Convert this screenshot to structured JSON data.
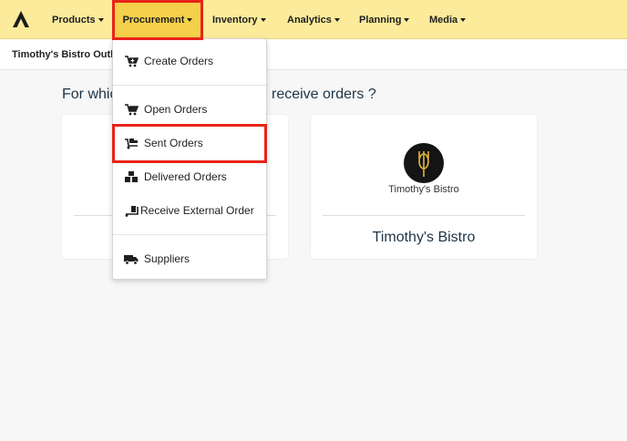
{
  "nav": {
    "items": [
      {
        "label": "Products"
      },
      {
        "label": "Procurement"
      },
      {
        "label": "Inventory"
      },
      {
        "label": "Analytics"
      },
      {
        "label": "Planning"
      },
      {
        "label": "Media"
      }
    ],
    "active_color": "#f5d04a",
    "bar_color": "#fbeb9b"
  },
  "subheader": {
    "outlet": "Timothy's Bistro Outlet"
  },
  "main": {
    "question_left": "For whic",
    "question_right": "receive orders ?",
    "cards": [
      {
        "name": ""
      },
      {
        "name": "Timothy's Bistro",
        "brand_text": "Timothy's Bistro"
      }
    ]
  },
  "dropdown": {
    "items": [
      {
        "label": "Create Orders",
        "icon": "cart-plus-icon"
      },
      {
        "label": "Open Orders",
        "icon": "cart-icon"
      },
      {
        "label": "Sent Orders",
        "icon": "dolly-icon"
      },
      {
        "label": "Delivered Orders",
        "icon": "boxes-icon"
      },
      {
        "label": "Receive External Order",
        "icon": "dolly-flatbed-icon"
      },
      {
        "label": "Suppliers",
        "icon": "truck-icon"
      }
    ]
  },
  "highlight_color": "#e8241a"
}
